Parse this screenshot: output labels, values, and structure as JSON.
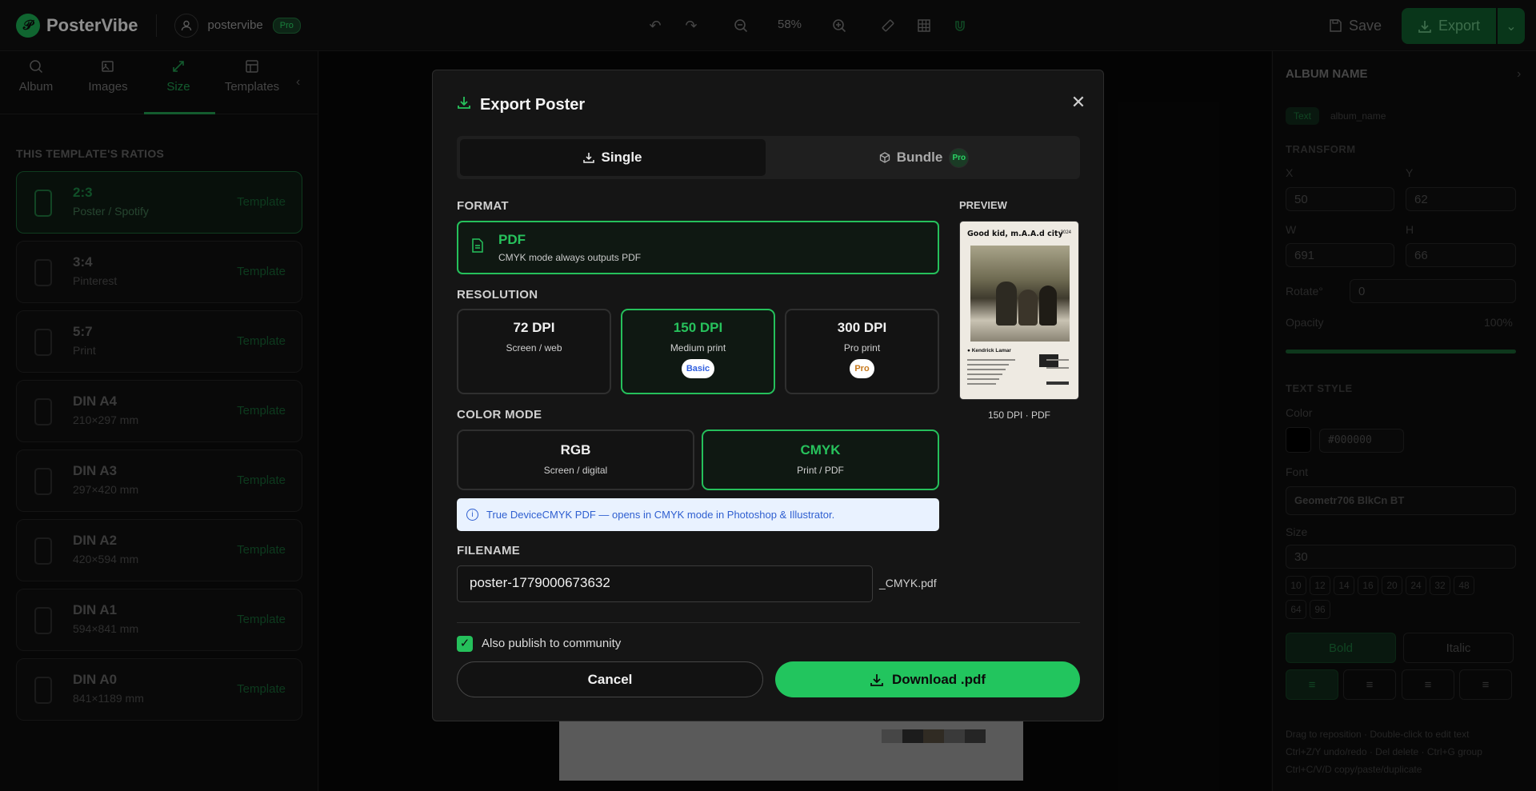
{
  "app": {
    "brand": "PosterVibe",
    "username": "postervibe",
    "plan_badge": "Pro",
    "zoom": "58%",
    "save_label": "Save",
    "export_label": "Export"
  },
  "left_panel": {
    "tabs": [
      {
        "label": "Album",
        "icon": "search-icon"
      },
      {
        "label": "Images",
        "icon": "image-plus-icon"
      },
      {
        "label": "Size",
        "icon": "resize-icon",
        "active": true
      },
      {
        "label": "Templates",
        "icon": "layout-icon"
      }
    ],
    "section_title": "THIS TEMPLATE'S RATIOS",
    "ratios": [
      {
        "name": "2:3",
        "sub": "Poster / Spotify",
        "tag": "Template",
        "active": true
      },
      {
        "name": "3:4",
        "sub": "Pinterest",
        "tag": "Template"
      },
      {
        "name": "5:7",
        "sub": "Print",
        "tag": "Template"
      },
      {
        "name": "DIN A4",
        "sub": "210×297 mm",
        "tag": "Template"
      },
      {
        "name": "DIN A3",
        "sub": "297×420 mm",
        "tag": "Template"
      },
      {
        "name": "DIN A2",
        "sub": "420×594 mm",
        "tag": "Template"
      },
      {
        "name": "DIN A1",
        "sub": "594×841 mm",
        "tag": "Template"
      },
      {
        "name": "DIN A0",
        "sub": "841×1189 mm",
        "tag": "Template"
      }
    ]
  },
  "right_panel": {
    "title": "ALBUM NAME",
    "chip_type": "Text",
    "chip_name": "album_name",
    "transform_title": "TRANSFORM",
    "x_label": "X",
    "x_value": "50",
    "y_label": "Y",
    "y_value": "62",
    "w_label": "W",
    "w_value": "691",
    "h_label": "H",
    "h_value": "66",
    "rotate_label": "Rotate°",
    "rotate_value": "0",
    "opacity_label": "Opacity",
    "opacity_value": "100%",
    "text_style_title": "TEXT STYLE",
    "color_label": "Color",
    "color_value": "#000000",
    "font_label": "Font",
    "font_value": "Geometr706 BlkCn BT",
    "size_label": "Size",
    "size_value": "30",
    "size_presets": [
      "10",
      "12",
      "14",
      "16",
      "20",
      "24",
      "32",
      "48",
      "64",
      "96"
    ],
    "bold_label": "Bold",
    "italic_label": "Italic",
    "help1": "Drag to reposition · Double-click to edit text",
    "help2": "Ctrl+Z/Y undo/redo · Del delete · Ctrl+G group",
    "help3": "Ctrl+C/V/D copy/paste/duplicate"
  },
  "modal": {
    "title": "Export Poster",
    "tab_single": "Single",
    "tab_bundle": "Bundle",
    "bundle_badge": "Pro",
    "format_label": "FORMAT",
    "format_name": "PDF",
    "format_desc": "CMYK mode always outputs PDF",
    "resolution_label": "RESOLUTION",
    "dpi_options": [
      {
        "name": "72 DPI",
        "desc": "Screen / web",
        "badge": ""
      },
      {
        "name": "150 DPI",
        "desc": "Medium print",
        "badge": "Basic",
        "selected": true
      },
      {
        "name": "300 DPI",
        "desc": "Pro print",
        "badge": "Pro"
      }
    ],
    "color_mode_label": "COLOR MODE",
    "color_modes": [
      {
        "name": "RGB",
        "desc": "Screen / digital"
      },
      {
        "name": "CMYK",
        "desc": "Print / PDF",
        "selected": true
      }
    ],
    "info_text": "True DeviceCMYK PDF — opens in CMYK mode in Photoshop & Illustrator.",
    "filename_label": "FILENAME",
    "filename_value": "poster-1779000673632",
    "filename_suffix": "_CMYK.pdf",
    "preview_label": "PREVIEW",
    "preview_caption": "150 DPI · PDF",
    "preview_album_title": "Good kid, m.A.A.d city",
    "preview_year": "2024",
    "preview_artist": "Kendrick Lamar",
    "publish_label": "Also publish to community",
    "publish_checked": true,
    "cancel_label": "Cancel",
    "download_label": "Download .pdf"
  },
  "colors": {
    "accent": "#22c55e",
    "background": "#0b0b0b",
    "modal": "#151515"
  }
}
